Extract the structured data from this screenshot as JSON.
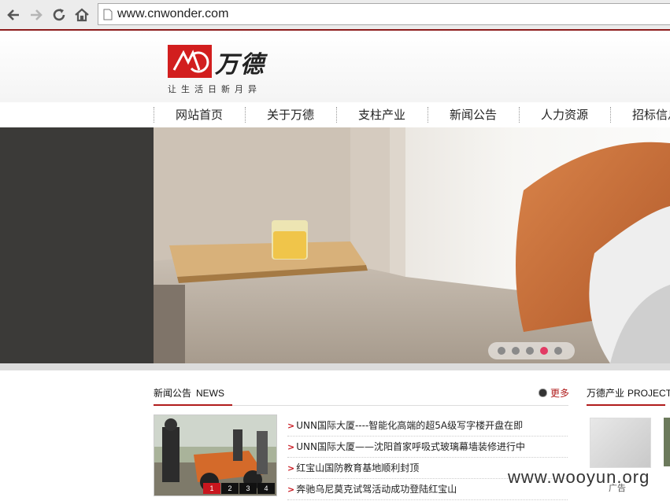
{
  "browser": {
    "url": "www.cnwonder.com",
    "back_icon": "back-arrow-icon",
    "forward_icon": "forward-arrow-icon",
    "reload_icon": "reload-icon",
    "home_icon": "home-icon"
  },
  "header": {
    "logo_text": "万德",
    "slogan": "让生活日新月异"
  },
  "nav": {
    "items": [
      "网站首页",
      "关于万德",
      "支柱产业",
      "新闻公告",
      "人力资源",
      "招标信息"
    ]
  },
  "banner": {
    "slides": 5,
    "active_slide": 4
  },
  "news": {
    "title_cn": "新闻公告",
    "title_en": "NEWS",
    "more": "更多",
    "pager": [
      "1",
      "2",
      "3",
      "4"
    ],
    "items": [
      "UNN国际大厦----智能化高端的超5A级写字楼开盘在即",
      "UNN国际大厦——沈阳首家呼吸式玻璃幕墙装修进行中",
      "红宝山国防教育基地顺利封顶",
      "奔驰乌尼莫克试驾活动成功登陆红宝山"
    ]
  },
  "projects": {
    "title_cn": "万德产业",
    "title_en": "PROJECT",
    "ad_label": "广告"
  },
  "watermark": "www.wooyun.org",
  "colors": {
    "brand_red": "#c8161e",
    "dark_red": "#8c1c1c",
    "dot_active": "#e23a63"
  }
}
